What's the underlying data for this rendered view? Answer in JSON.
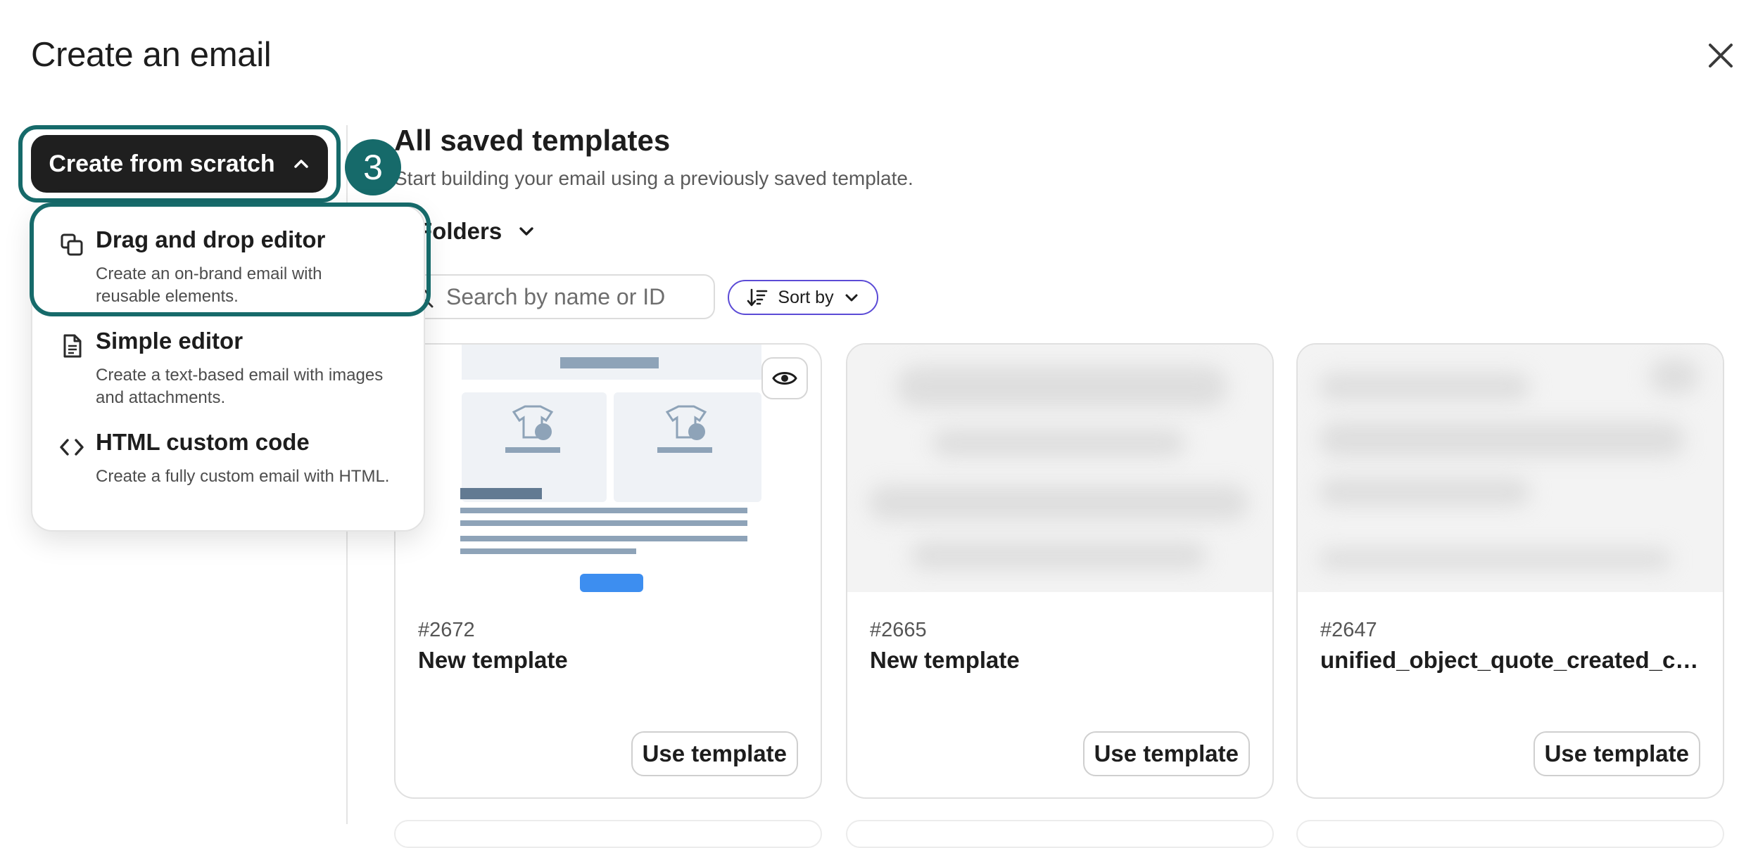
{
  "dialog": {
    "title": "Create an email"
  },
  "sidebar": {
    "create_button_label": "Create from scratch",
    "step_number": "3",
    "menu": [
      {
        "title": "Drag and drop editor",
        "description": "Create an on-brand email with reusable elements."
      },
      {
        "title": "Simple editor",
        "description": "Create a text-based email with images and attachments."
      },
      {
        "title": "HTML custom code",
        "description": "Create a fully custom email with HTML."
      }
    ]
  },
  "main": {
    "title": "All saved templates",
    "subtitle": "Start building your email using a previously saved template.",
    "folders_label": "Folders",
    "search": {
      "placeholder": "Search by name or ID",
      "value": ""
    },
    "sort_label": "Sort by",
    "templates": [
      {
        "id": "#2672",
        "name": "New template",
        "action": "Use template"
      },
      {
        "id": "#2665",
        "name": "New template",
        "action": "Use template"
      },
      {
        "id": "#2647",
        "name": "unified_object_quote_created_co...",
        "action": "Use template"
      }
    ]
  },
  "colors": {
    "highlight": "#166a6a",
    "primary_button": "#1f1f1f",
    "sort_border": "#5b4bd6",
    "thumb_blue": "#3d8ef0"
  }
}
